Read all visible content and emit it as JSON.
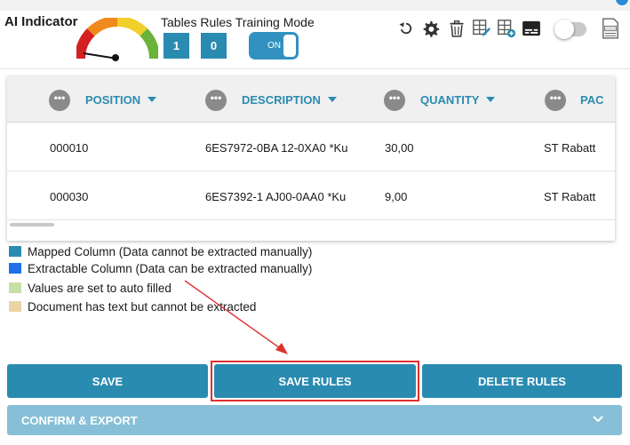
{
  "header": {
    "ai_indicator_label": "AI Indicator",
    "stats_label": "Tables Rules Training Mode",
    "tables_count": "1",
    "rules_count": "0",
    "training_mode_label": "ON",
    "gauge_level": 0.15
  },
  "icons": [
    "undo-icon",
    "settings-icon",
    "trash-icon",
    "table-edit-icon",
    "table-add-icon",
    "subtitles-icon",
    "toggle-switch",
    "ocr-icon"
  ],
  "table": {
    "columns": [
      "POSITION",
      "DESCRIPTION",
      "QUANTITY",
      "PAC"
    ],
    "rows": [
      [
        "000010",
        "6ES7972-0BA 12-0XA0 *Ku",
        "30,00",
        "ST Rabatt"
      ],
      [
        "000030",
        "6ES7392-1 AJ00-0AA0 *Ku",
        "9,00",
        "ST Rabatt"
      ]
    ]
  },
  "legend": [
    {
      "color": "#2a8bb0",
      "label": "Mapped Column (Data cannot be extracted manually)"
    },
    {
      "color": "#1f6fe8",
      "label": "Extractable Column (Data can be extracted manually)"
    },
    {
      "color": "#c7dfa8",
      "label": "Values are set to auto filled"
    },
    {
      "color": "#ecd3a6",
      "label": "Document has text but cannot be extracted"
    }
  ],
  "buttons": {
    "save": "SAVE",
    "save_rules": "SAVE RULES",
    "delete_rules": "DELETE RULES",
    "confirm_export": "CONFIRM & EXPORT"
  },
  "colors": {
    "accent": "#2a8bb0",
    "highlight": "#e03030"
  }
}
